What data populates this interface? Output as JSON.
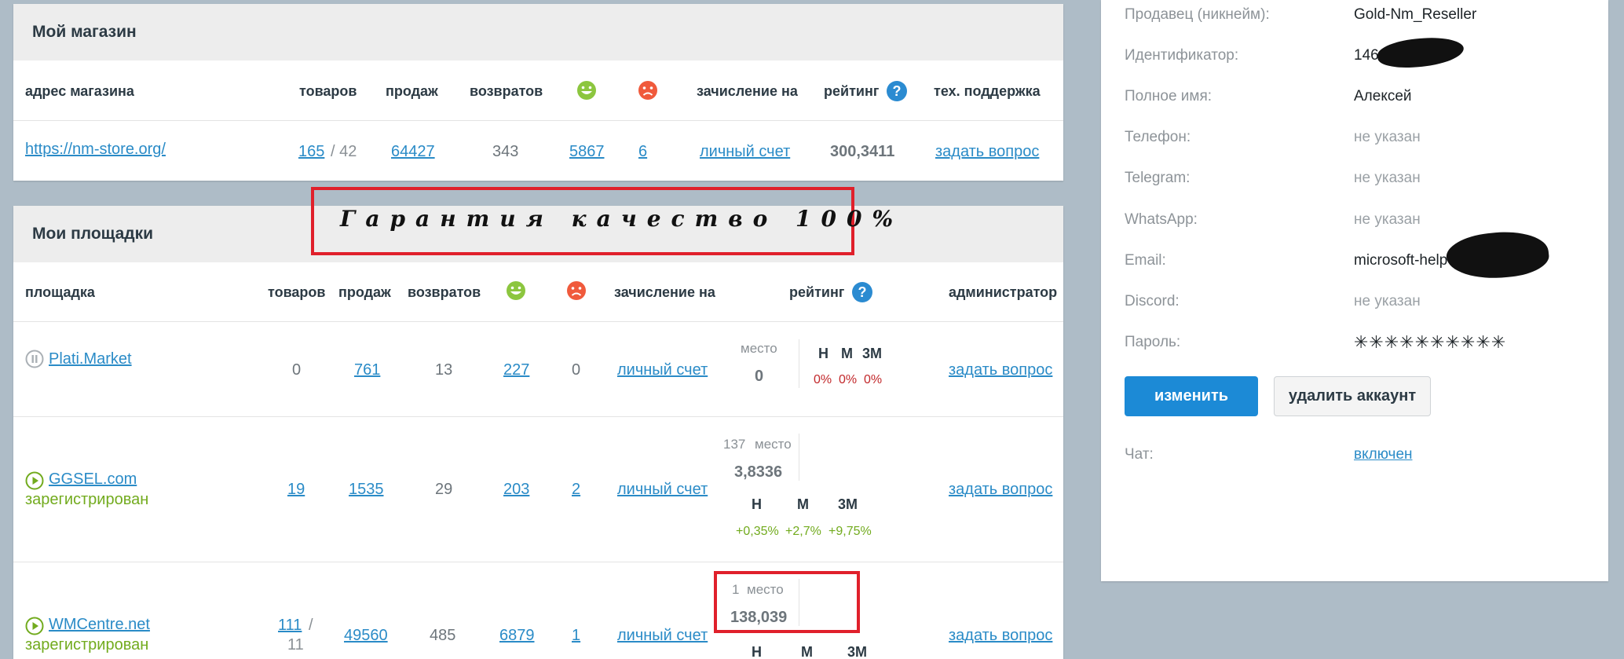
{
  "shop": {
    "title": "Мой магазин",
    "headers": {
      "address": "адрес магазина",
      "goods": "товаров",
      "sales": "продаж",
      "returns": "возвратов",
      "credit": "зачисление на",
      "rating": "рейтинг",
      "support": "тех. поддержка"
    },
    "row": {
      "url": "https://nm-store.org/",
      "goods": "165",
      "goods_total": "/ 42",
      "sales": "64427",
      "returns": "343",
      "positive": "5867",
      "negative": "6",
      "credit": "личный счет",
      "rating": "300,3411",
      "support": "задать вопрос"
    }
  },
  "banner": {
    "text": "Гарантия качество 100%"
  },
  "platforms": {
    "title": "Мои площадки",
    "headers": {
      "platform": "площадка",
      "goods": "товаров",
      "sales": "продаж",
      "returns": "возвратов",
      "credit": "зачисление на",
      "rating": "рейтинг",
      "admin": "администратор"
    },
    "place_word": "место",
    "col_h": "Н",
    "col_m": "М",
    "col_3m": "3М",
    "rows": [
      {
        "name": "Plati.Market",
        "status": "",
        "goods": "0",
        "goods_total": "",
        "sales": "761",
        "returns": "13",
        "positive": "227",
        "negative": "0",
        "credit": "личный счет",
        "place": "",
        "score": "0",
        "h": "0%",
        "m": "0%",
        "m3": "0%",
        "admin": "задать вопрос"
      },
      {
        "name": "GGSEL.com",
        "status": "зарегистрирован",
        "goods": "19",
        "goods_total": "",
        "sales": "1535",
        "returns": "29",
        "positive": "203",
        "negative": "2",
        "credit": "личный счет",
        "place": "137",
        "score": "3,8336",
        "h": "+0,35%",
        "m": "+2,7%",
        "m3": "+9,75%",
        "admin": "задать вопрос"
      },
      {
        "name": "WMCentre.net",
        "status": "зарегистрирован",
        "goods": "111",
        "goods_total": "/",
        "goods_total2": "11",
        "sales": "49560",
        "returns": "485",
        "positive": "6879",
        "negative": "1",
        "credit": "личный счет",
        "place": "1",
        "score": "138,039",
        "h": "",
        "m": "",
        "m3": "",
        "admin": "задать вопрос"
      }
    ]
  },
  "profile": {
    "fields": [
      {
        "label": "Продавец (никнейм):",
        "value": "Gold-Nm_Reseller",
        "muted": false
      },
      {
        "label": "Идентификатор:",
        "value": "146611",
        "muted": false
      },
      {
        "label": "Полное имя:",
        "value": "Алексей",
        "muted": false
      },
      {
        "label": "Телефон:",
        "value": "не указан",
        "muted": true
      },
      {
        "label": "Telegram:",
        "value": "не указан",
        "muted": true
      },
      {
        "label": "WhatsApp:",
        "value": "не указан",
        "muted": true
      },
      {
        "label": "Email:",
        "value": "microsoft-help-",
        "muted": false
      },
      {
        "label": "Discord:",
        "value": "не указан",
        "muted": true
      },
      {
        "label": "Пароль:",
        "value": "✳✳✳✳✳✳✳✳✳✳",
        "muted": false
      }
    ],
    "edit_button": "изменить",
    "delete_button": "удалить аккаунт",
    "chat_label": "Чат:",
    "chat_value": "включен"
  },
  "colors": {
    "accent": "#2a8bc7",
    "positive": "#72ab1e",
    "negative": "#c2282b",
    "highlight": "#e0202b"
  }
}
